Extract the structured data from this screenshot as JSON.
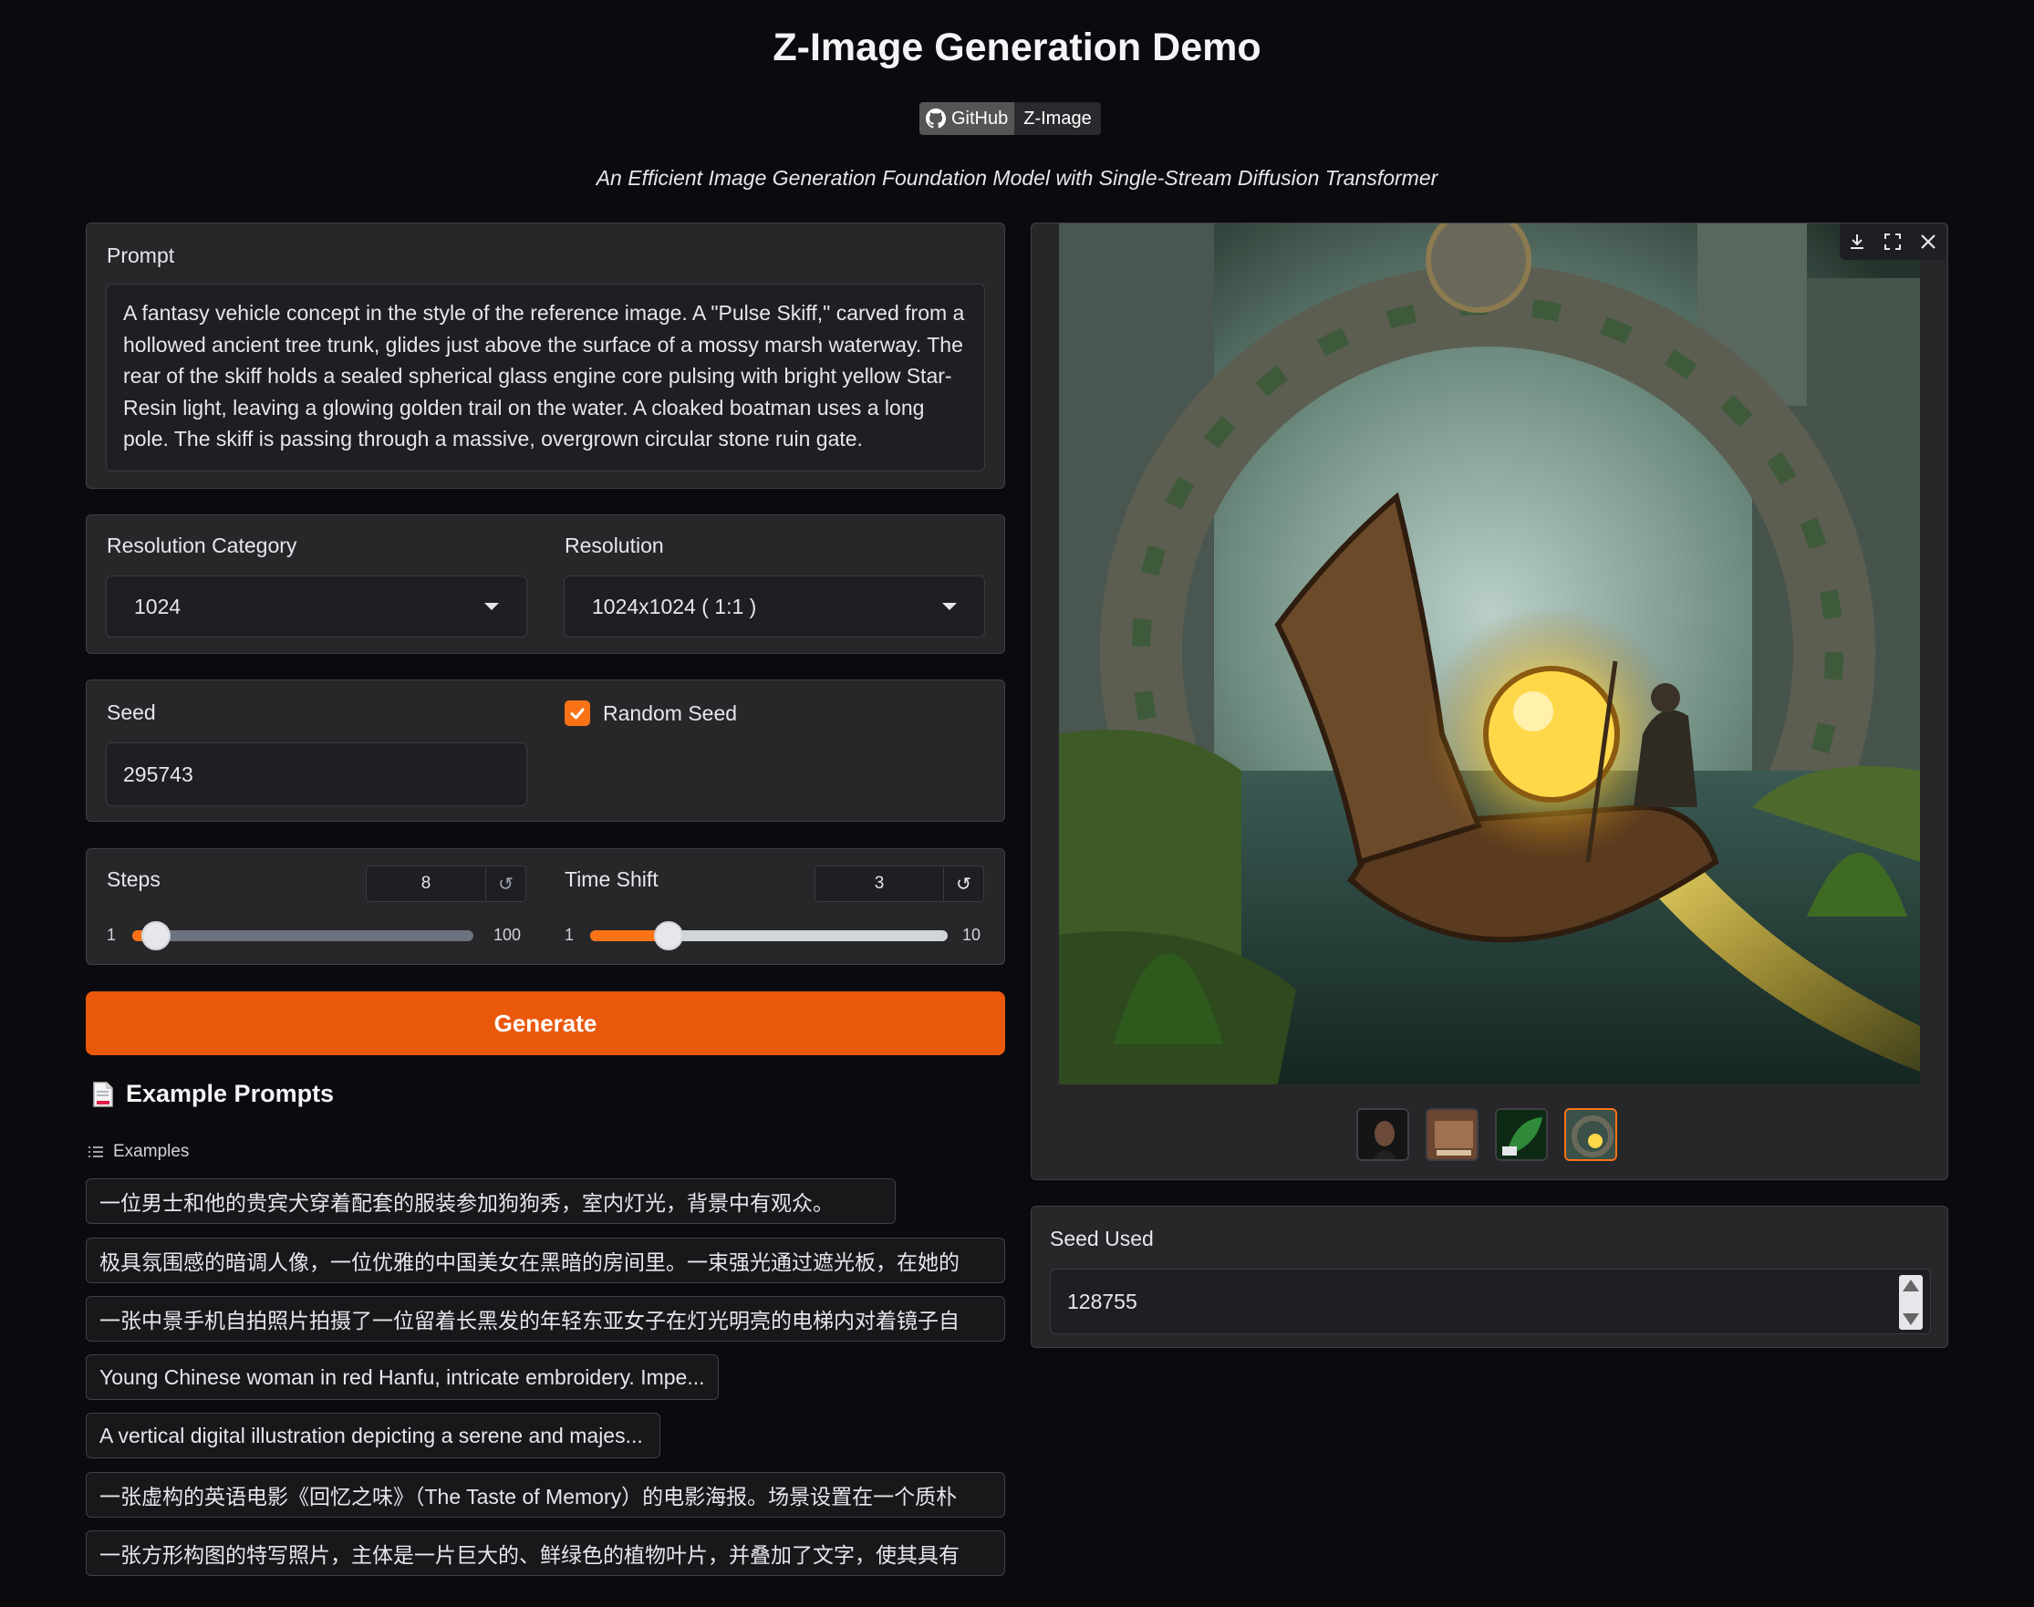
{
  "header": {
    "title": "Z-Image Generation Demo",
    "badge_left": "GitHub",
    "badge_right": "Z-Image",
    "subtitle": "An Efficient Image Generation Foundation Model with Single-Stream Diffusion Transformer"
  },
  "prompt": {
    "label": "Prompt",
    "value": "A fantasy vehicle concept in the style of the reference image. A \"Pulse Skiff,\" carved from a hollowed ancient tree trunk, glides just above the surface of a mossy marsh waterway. The rear of the skiff holds a sealed spherical glass engine core pulsing with bright yellow Star-Resin light, leaving a glowing golden trail on the water. A cloaked boatman uses a long pole. The skiff is passing through a massive, overgrown circular stone ruin gate."
  },
  "resolution": {
    "category_label": "Resolution Category",
    "category_value": "1024",
    "resolution_label": "Resolution",
    "resolution_value": "1024x1024 ( 1:1 )"
  },
  "seed": {
    "label": "Seed",
    "value": "295743",
    "random_label": "Random Seed",
    "random_checked": true
  },
  "steps": {
    "label": "Steps",
    "value": "8",
    "min": "1",
    "max": "100",
    "level": 0.07
  },
  "time_shift": {
    "label": "Time Shift",
    "value": "3",
    "min": "1",
    "max": "10",
    "level": 0.22
  },
  "generate_label": "Generate",
  "examples": {
    "heading": "Example Prompts",
    "sub": "Examples",
    "items": [
      "一位男士和他的贵宾犬穿着配套的服装参加狗狗秀，室内灯光，背景中有观众。",
      "极具氛围感的暗调人像，一位优雅的中国美女在黑暗的房间里。一束强光通过遮光板，在她的",
      "一张中景手机自拍照片拍摄了一位留着长黑发的年轻东亚女子在灯光明亮的电梯内对着镜子自",
      "Young Chinese woman in red Hanfu, intricate embroidery. Impe...",
      "A vertical digital illustration depicting a serene and majes...",
      "一张虚构的英语电影《回忆之味》（The Taste of Memory）的电影海报。场景设置在一个质朴",
      "一张方形构图的特写照片，主体是一片巨大的、鲜绿色的植物叶片，并叠加了文字，使其具有"
    ]
  },
  "seed_used": {
    "label": "Seed Used",
    "value": "128755"
  },
  "colors": {
    "accent": "#ea580c",
    "background": "#0b0b0f",
    "panel": "#27272a"
  }
}
